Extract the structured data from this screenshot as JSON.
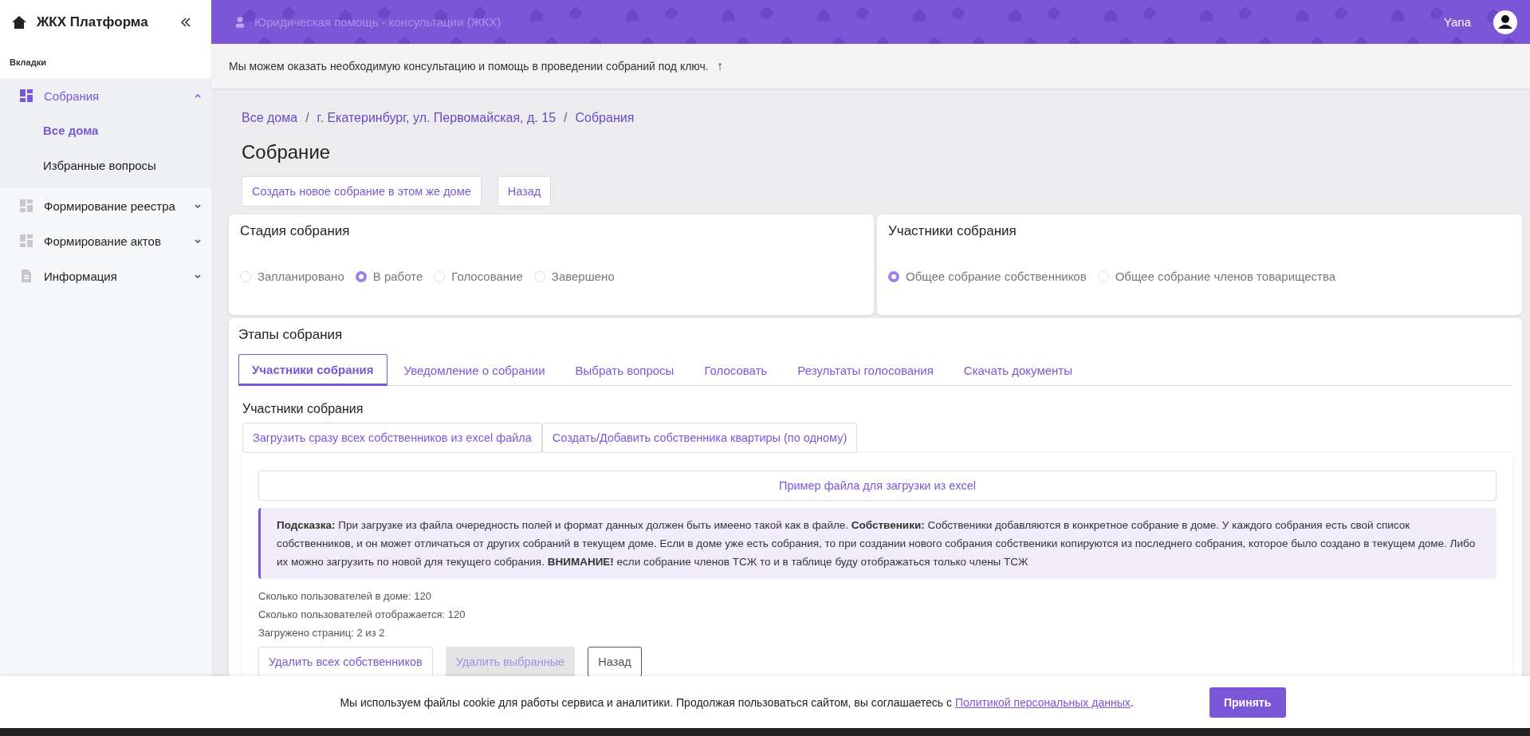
{
  "brand": {
    "title": "ЖКХ Платформа"
  },
  "header": {
    "title": "Юридическая помощь - консультации (ЖКХ)",
    "user": "Yana"
  },
  "notice": {
    "text": "Мы можем оказать необходимую консультацию и помощь в проведении собраний под ключ.",
    "arrow": "↑"
  },
  "sidebar": {
    "section": "Вкладки",
    "items": [
      {
        "label": "Собрания",
        "kind": "grid",
        "selected": true,
        "expanded": true,
        "children": [
          {
            "label": "Все дома",
            "selected": true
          },
          {
            "label": "Избранные вопросы",
            "selected": false
          }
        ]
      },
      {
        "label": "Формирование реестра",
        "kind": "grid",
        "selected": false,
        "expanded": false
      },
      {
        "label": "Формирование актов",
        "kind": "grid",
        "selected": false,
        "expanded": false
      },
      {
        "label": "Информация",
        "kind": "document",
        "selected": false,
        "expanded": false
      }
    ]
  },
  "breadcrumbs": [
    "Все дома",
    "г. Екатеринбург, ул. Первомайская, д. 15",
    "Собрания"
  ],
  "breadcrumb_separator": "/",
  "page_title": "Собрание",
  "top_buttons": [
    "Создать новое собрание в этом же доме",
    "Назад"
  ],
  "stage_card": {
    "title": "Стадия собрания",
    "options": [
      {
        "label": "Запланировано",
        "selected": false
      },
      {
        "label": "В работе",
        "selected": true
      },
      {
        "label": "Голосование",
        "selected": false
      },
      {
        "label": "Завершено",
        "selected": false
      }
    ]
  },
  "participants_card": {
    "title": "Участники собрания",
    "options": [
      {
        "label": "Общее собрание собственников",
        "selected": true
      },
      {
        "label": "Общее собрание членов товарищества",
        "selected": false
      }
    ]
  },
  "stages": {
    "title": "Этапы собрания",
    "tabs": [
      {
        "label": "Участники собрания",
        "selected": true
      },
      {
        "label": "Уведомление о собрании",
        "selected": false
      },
      {
        "label": "Выбрать вопросы",
        "selected": false
      },
      {
        "label": "Голосовать",
        "selected": false
      },
      {
        "label": "Результаты голосования",
        "selected": false
      },
      {
        "label": "Скачать документы",
        "selected": false
      }
    ],
    "subtitle": "Участники собрания",
    "upload_buttons": [
      "Загрузить сразу всех собственников из excel файла",
      "Создать/Добавить собственника квартиры (по одному)"
    ],
    "example_button": "Пример файла для загрузки из excel",
    "hint": "**Подсказка:** При загрузке из файла очередность полей и формат данных должен быть имеено такой как в файле. **Собственики:** Собственики добавляются в конкретное собрание в доме. У каждого собрания есть свой список собственников, и он может отличаться от других собраний в текущем доме. Если в доме уже есть собрания, то при создании нового собрания собственики копируются из последнего собрания, которое было создано в текущем доме. Либо их можно загрузить по новой для текущего собрания. **ВНИМАНИЕ!** если собрание членов ТСЖ то и в таблице буду отображаться только члены ТСЖ",
    "stats": [
      "Сколько пользователей в доме: 120",
      "Сколько пользователей отображается: 120",
      "Загружено страниц: 2 из 2"
    ],
    "actions": [
      {
        "label": "Удалить всех собственников",
        "kind": "default",
        "disabled": false
      },
      {
        "label": "Удалить выбранные",
        "kind": "default",
        "disabled": true
      },
      {
        "label": "Назад",
        "kind": "dark",
        "disabled": false
      }
    ]
  },
  "cookie": {
    "text": "Мы используем файлы cookie для работы сервиса и аналитики. Продолжая пользоваться сайтом, вы соглашаетесь с",
    "link": "Политикой персональных данных",
    "end": ".",
    "button": "Принять"
  }
}
